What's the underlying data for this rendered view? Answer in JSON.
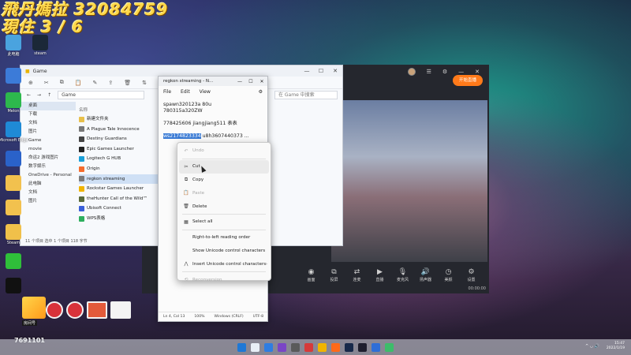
{
  "overlay": {
    "line1": "飛丹媽拉 32084759",
    "line2": "現住 3 / 6"
  },
  "desktop_icons": [
    {
      "label": "此电脑",
      "color": "#4aa3df"
    },
    {
      "label": "steam",
      "color": "#1b2838"
    }
  ],
  "left_icons": [
    {
      "label": "",
      "color": "#3c7bd8"
    },
    {
      "label": "Melon",
      "color": "#2db84d"
    },
    {
      "label": "Microsoft Edge",
      "color": "#1f8ad6"
    },
    {
      "label": "",
      "color": "#2a62c9"
    },
    {
      "label": "",
      "color": "#f2c14e"
    },
    {
      "label": "",
      "color": "#f2c14e"
    },
    {
      "label": "Steam",
      "color": "#f0c04a"
    },
    {
      "label": "",
      "color": "#2fbf3a"
    },
    {
      "label": "",
      "color": "#111"
    }
  ],
  "explorer": {
    "title": "Game",
    "path": "Game",
    "search_placeholder": "在 Game 中搜索",
    "nav": [
      "桌面",
      "下载",
      "文档",
      "图片",
      "Game",
      "movie",
      "命运2 游戏图片",
      "数字娱乐",
      "OneDrive - Personal",
      "此电脑",
      "文档",
      "图片"
    ],
    "list_header": "名称",
    "items": [
      {
        "name": "新建文件夹",
        "color": "#e8c04a"
      },
      {
        "name": "A Plague Tale Innocence",
        "color": "#777"
      },
      {
        "name": "Destiny Guardians",
        "color": "#444"
      },
      {
        "name": "Epic Games Launcher",
        "color": "#222"
      },
      {
        "name": "Logitech G HUB",
        "color": "#1aa0d8"
      },
      {
        "name": "Origin",
        "color": "#f56c2d"
      },
      {
        "name": "regkon streaming",
        "color": "#7a7a7a"
      },
      {
        "name": "Rockstar Games Launcher",
        "color": "#f0b400"
      },
      {
        "name": "theHunter Call of the Wild™",
        "color": "#5a6b3a"
      },
      {
        "name": "Ubisoft Connect",
        "color": "#3a5fd8"
      },
      {
        "name": "WPS表格",
        "color": "#2dae5e"
      }
    ],
    "status": "11 个项目   选中 1 个项目  118 字节"
  },
  "notepad": {
    "title": "regkon streaming - N...",
    "menu": [
      "File",
      "Edit",
      "View"
    ],
    "lines": [
      "spawn320123a    80u",
      "780315a320ZW"
    ],
    "line3": "778425606 jiangjiang511  表表",
    "sel_text": "ws2174823334",
    "after_sel": "  u8h3607440373  ...",
    "status": [
      "Ln 4, Col 13",
      "100%",
      "Windows (CRLF)",
      "UTF-8"
    ]
  },
  "context_menu": [
    {
      "icon": "↶",
      "label": "Undo",
      "enabled": false,
      "name": "undo"
    },
    {
      "sep": true
    },
    {
      "icon": "✂",
      "label": "Cut",
      "enabled": true,
      "name": "cut",
      "hover": true
    },
    {
      "icon": "⧉",
      "label": "Copy",
      "enabled": true,
      "name": "copy"
    },
    {
      "icon": "📋",
      "label": "Paste",
      "enabled": false,
      "name": "paste"
    },
    {
      "icon": "🗑",
      "label": "Delete",
      "enabled": true,
      "name": "delete"
    },
    {
      "sep": true
    },
    {
      "icon": "▦",
      "label": "Select all",
      "enabled": true,
      "name": "select-all"
    },
    {
      "sep": true
    },
    {
      "icon": "",
      "label": "Right-to-left reading order",
      "enabled": true,
      "name": "rtl"
    },
    {
      "icon": "",
      "label": "Show Unicode control characters",
      "enabled": true,
      "name": "show-unicode"
    },
    {
      "icon": "⋀",
      "label": "Insert Unicode control characters",
      "enabled": true,
      "name": "insert-unicode",
      "submenu": true
    },
    {
      "sep": true
    },
    {
      "icon": "⟲",
      "label": "Reconversion",
      "enabled": false,
      "name": "reconversion"
    }
  ],
  "stream_app": {
    "tools": [
      {
        "icon": "◉",
        "label": "画面"
      },
      {
        "icon": "⧉",
        "label": "投屏"
      },
      {
        "icon": "⇄",
        "label": "连麦"
      },
      {
        "icon": "▶",
        "label": "直播"
      },
      {
        "icon": "🎙",
        "label": "麦克风"
      },
      {
        "icon": "🔊",
        "label": "扬声器"
      },
      {
        "icon": "◷",
        "label": "美颜"
      },
      {
        "icon": "⚙",
        "label": "设置"
      }
    ],
    "live_button": "开始直播",
    "timer": "00:00:00",
    "accent": "#ff7a1a"
  },
  "widget": {
    "label": "房间号",
    "room_id": "7691101"
  },
  "taskbar": {
    "icons": [
      "#1e78d6",
      "#e8eef6",
      "#2f7de1",
      "#7a45c6",
      "#5a5a5a",
      "#d63a3a",
      "#f0b400",
      "#ff6a1a",
      "#17294a",
      "#1e1e2e",
      "#2f6ed6",
      "#3dbd6a"
    ],
    "time": "15:47",
    "date": "2022/1/19",
    "tray": "^ ◡ 🔊"
  }
}
